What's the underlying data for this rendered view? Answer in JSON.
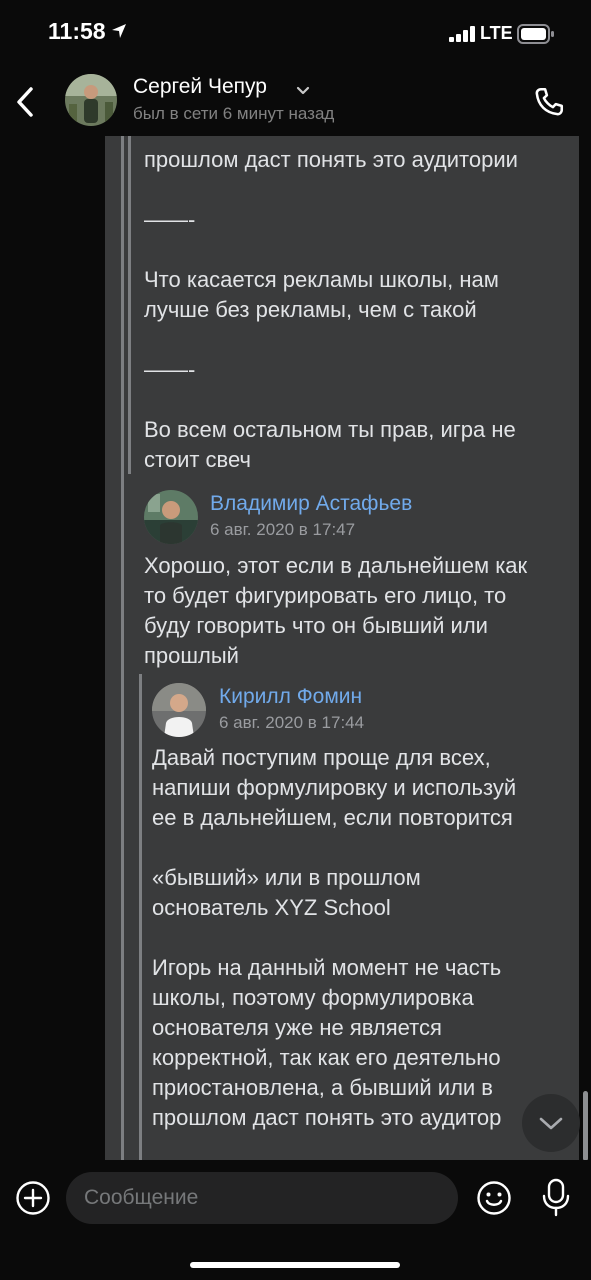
{
  "status_bar": {
    "time": "11:58",
    "network": "LTE"
  },
  "header": {
    "contact_name": "Сергей Чепур",
    "contact_status": "был в сети 6 минут назад"
  },
  "messages": {
    "outer_tail": {
      "lines": "прошлом даст понять это аудитории\n\n——-\n\nЧто касается рекламы школы, нам\nлучше без рекламы, чем с такой\n\n——-\n\nВо всем остальном ты прав, игра не\nстоит свеч"
    },
    "forward_1": {
      "author": "Владимир Астафьев",
      "date": "6 авг. 2020 в 17:47",
      "text": "Хорошо, этот если в дальнейшем как\nто будет фигурировать его лицо, то\nбуду говорить что он бывший или\nпрошлый"
    },
    "forward_2": {
      "author": "Кирилл Фомин",
      "date": "6 авг. 2020 в 17:44",
      "text": "Давай поступим проще для всех,\nнапиши формулировку и используй\nее в дальнейшем, если повторится\n\n«бывший» или в прошлом\nоснователь XYZ School\n\nИгорь на данный момент не часть\nшколы, поэтому формулировка\nоснователя уже не является\nкорректной, так как его деятельно\nприостановлена, а бывший или в\nпрошлом даст понять это аудитор"
    }
  },
  "input": {
    "placeholder": "Сообщение"
  },
  "colors": {
    "bubble": "#3a3b3c",
    "link": "#71aaeb",
    "background": "#0a0a0a"
  }
}
